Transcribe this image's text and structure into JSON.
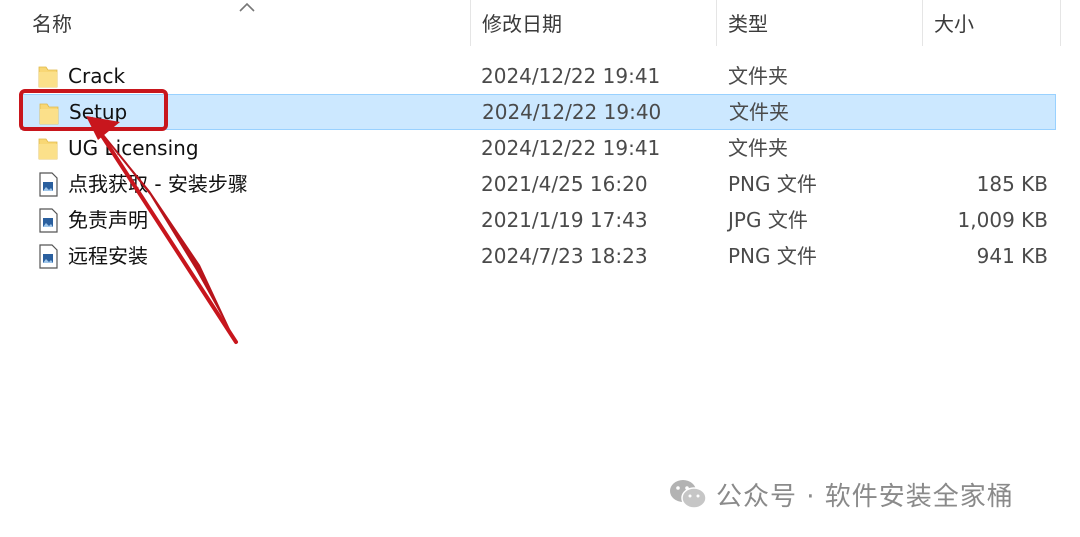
{
  "header": {
    "col_name": "名称",
    "col_date": "修改日期",
    "col_type": "类型",
    "col_size": "大小"
  },
  "files": [
    {
      "name": "Crack",
      "date": "2024/12/22 19:41",
      "type": "文件夹",
      "size": "",
      "icon": "folder-icon",
      "selected": false
    },
    {
      "name": "Setup",
      "date": "2024/12/22 19:40",
      "type": "文件夹",
      "size": "",
      "icon": "folder-icon",
      "selected": true
    },
    {
      "name": "UG Licensing",
      "date": "2024/12/22 19:41",
      "type": "文件夹",
      "size": "",
      "icon": "folder-icon",
      "selected": false
    },
    {
      "name": "点我获取 - 安装步骤",
      "date": "2021/4/25 16:20",
      "type": "PNG 文件",
      "size": "185 KB",
      "icon": "image-file-icon",
      "selected": false
    },
    {
      "name": "免责声明",
      "date": "2021/1/19 17:43",
      "type": "JPG 文件",
      "size": "1,009 KB",
      "icon": "image-file-icon",
      "selected": false
    },
    {
      "name": "远程安装",
      "date": "2024/7/23 18:23",
      "type": "PNG 文件",
      "size": "941 KB",
      "icon": "image-file-icon",
      "selected": false
    }
  ],
  "watermark": {
    "text": "公众号 · 软件安装全家桶"
  },
  "colors": {
    "selection_bg": "#cce8ff",
    "selection_border": "#99d1ff",
    "annotation_red": "#c8161d",
    "folder_yellow": "#f8d775"
  }
}
